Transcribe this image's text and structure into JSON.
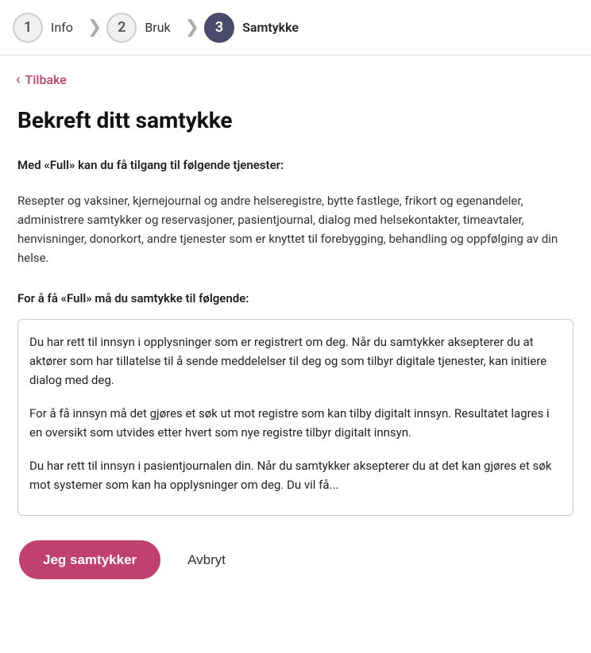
{
  "stepper": {
    "steps": [
      {
        "number": "1",
        "label": "Info",
        "state": "inactive"
      },
      {
        "number": "2",
        "label": "Bruk",
        "state": "inactive"
      },
      {
        "number": "3",
        "label": "Samtykke",
        "state": "active"
      }
    ],
    "arrow": "❯"
  },
  "back_link": {
    "label": "Tilbake",
    "chevron": "‹"
  },
  "page_title": "Bekreft ditt samtykke",
  "intro_text": "Med «Full» kan du få tilgang til følgende tjenester:",
  "body_text": "Resepter og vaksiner, kjernejournal og andre helseregistre, bytte fastlege, frikort og egenandeler, administrere samtykker og reservasjoner, pasientjournal, dialog med helsekontakter, timeavtaler, henvisninger, donorkort, andre tjenester som er knyttet til forebygging, behandling og oppfølging av din helse.",
  "condition_label": "For å få «Full» må du samtykke til følgende:",
  "scroll_content": {
    "paragraph1": "Du har rett til innsyn i opplysninger som er registrert om deg. Når du samtykker aksepterer du at aktører som har tillatelse til å sende meddelelser til deg og som tilbyr digitale tjenester, kan initiere dialog med deg.",
    "paragraph2": "For å få innsyn må det gjøres et søk ut mot registre som kan tilby digitalt innsyn. Resultatet lagres i en oversikt som utvides etter hvert som nye registre tilbyr digitalt innsyn.",
    "paragraph3": "Du har rett til innsyn i pasientjournalen din. Når du samtykker aksepterer du at det kan gjøres et søk mot systemer som kan ha opplysninger om deg. Du vil få..."
  },
  "buttons": {
    "primary_label": "Jeg samtykker",
    "secondary_label": "Avbryt"
  }
}
